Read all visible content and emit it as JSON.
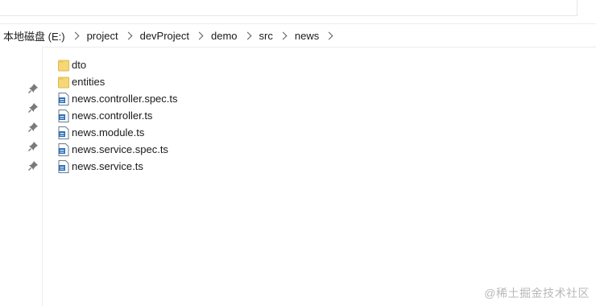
{
  "address": {
    "segments": [
      "本地磁盘 (E:)",
      "project",
      "devProject",
      "demo",
      "src",
      "news"
    ]
  },
  "nav_pane": {
    "pin_icon": "pin-icon",
    "pin_count": 5
  },
  "files": [
    {
      "name": "dto",
      "type": "folder"
    },
    {
      "name": "entities",
      "type": "folder"
    },
    {
      "name": "news.controller.spec.ts",
      "type": "ts-file"
    },
    {
      "name": "news.controller.ts",
      "type": "ts-file"
    },
    {
      "name": "news.module.ts",
      "type": "ts-file"
    },
    {
      "name": "news.service.spec.ts",
      "type": "ts-file"
    },
    {
      "name": "news.service.ts",
      "type": "ts-file"
    }
  ],
  "watermark": "@稀土掘金技术社区",
  "colors": {
    "folder": "#f5d777",
    "folder_edge": "#e0b848",
    "ts_icon": "#2a6db8"
  }
}
